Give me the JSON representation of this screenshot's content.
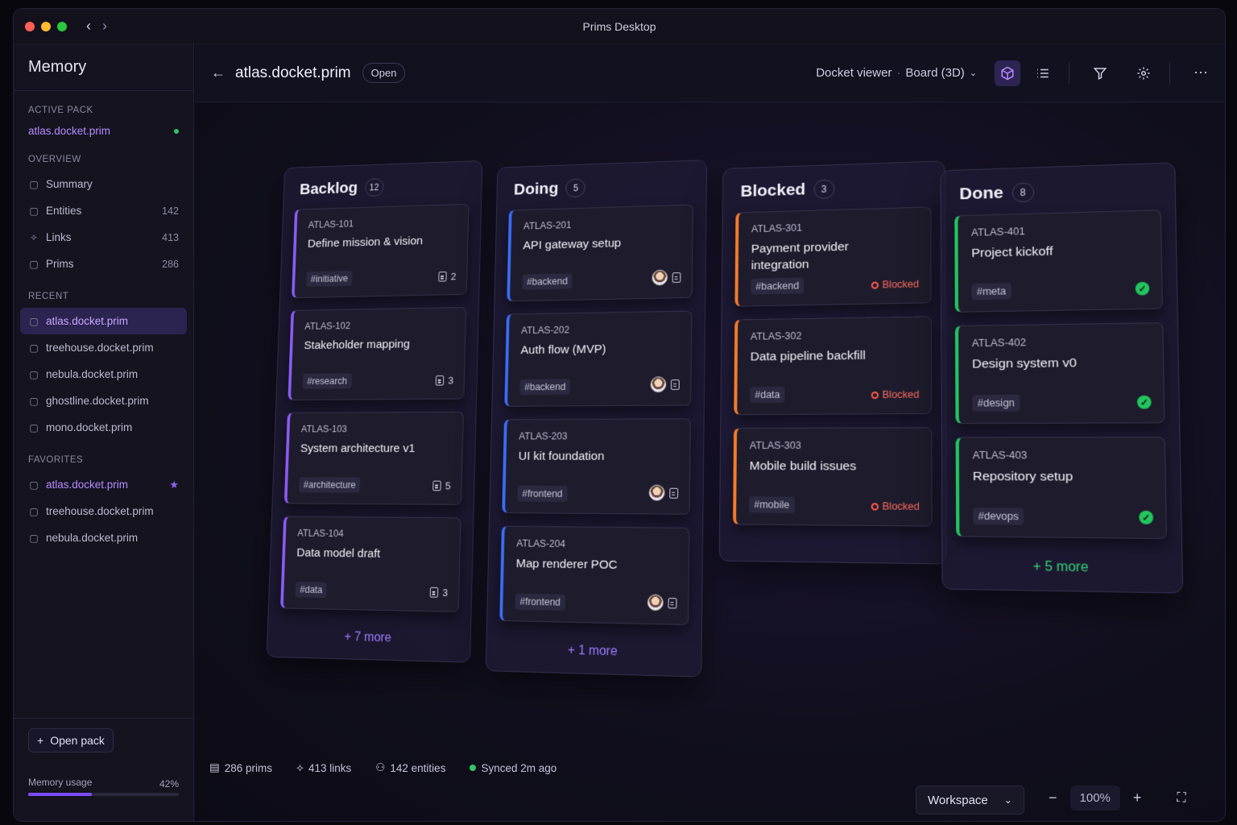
{
  "window": {
    "title": "Prims Desktop",
    "controls": [
      "#ff5f57",
      "#febc2e",
      "#28c840"
    ]
  },
  "sidebar": {
    "title": "Memory",
    "active_pack_label": "ACTIVE PACK",
    "active_pack": "atlas.docket.prim",
    "overview_label": "OVERVIEW",
    "overview": [
      {
        "label": "Summary",
        "count": "",
        "icon": "document-icon"
      },
      {
        "label": "Entities",
        "count": "142",
        "icon": "document-icon"
      },
      {
        "label": "Links",
        "count": "413",
        "icon": "link-icon"
      },
      {
        "label": "Prims",
        "count": "286",
        "icon": "prim-icon"
      }
    ],
    "recent_label": "RECENT",
    "recent": [
      "atlas.docket.prim",
      "treehouse.docket.prim",
      "nebula.docket.prim",
      "ghostline.docket.prim",
      "mono.docket.prim"
    ],
    "favorites_label": "FAVORITES",
    "favorites": [
      "atlas.docket.prim",
      "treehouse.docket.prim",
      "nebula.docket.prim"
    ],
    "open_pack": "Open pack",
    "memory_usage_label": "Memory usage",
    "memory_usage": "42%",
    "memory_usage_fraction": 0.42
  },
  "header": {
    "doc_name": "atlas.docket.prim",
    "status_pill": "Open",
    "viewer": "Docket viewer",
    "view_mode": "Board (3D)"
  },
  "board": {
    "columns": [
      {
        "name": "Backlog",
        "count": "12",
        "accent": "#8b5cf6",
        "more": "+ 7 more",
        "cards": [
          {
            "id": "ATLAS-101",
            "title": "Define mission & vision",
            "tag": "#initiative",
            "docs": "2"
          },
          {
            "id": "ATLAS-102",
            "title": "Stakeholder mapping",
            "tag": "#research",
            "docs": "3"
          },
          {
            "id": "ATLAS-103",
            "title": "System architecture v1",
            "tag": "#architecture",
            "docs": "5"
          },
          {
            "id": "ATLAS-104",
            "title": "Data model draft",
            "tag": "#data",
            "docs": "3"
          }
        ]
      },
      {
        "name": "Doing",
        "count": "5",
        "accent": "#3b6cf6",
        "more": "+ 1 more",
        "cards": [
          {
            "id": "ATLAS-201",
            "title": "API gateway setup",
            "tag": "#backend"
          },
          {
            "id": "ATLAS-202",
            "title": "Auth flow (MVP)",
            "tag": "#backend"
          },
          {
            "id": "ATLAS-203",
            "title": "UI kit foundation",
            "tag": "#frontend"
          },
          {
            "id": "ATLAS-204",
            "title": "Map renderer POC",
            "tag": "#frontend"
          }
        ]
      },
      {
        "name": "Blocked",
        "count": "3",
        "accent": "#f57c2a",
        "more": "",
        "cards": [
          {
            "id": "ATLAS-301",
            "title": "Payment provider integration",
            "tag": "#backend",
            "status": "Blocked"
          },
          {
            "id": "ATLAS-302",
            "title": "Data pipeline backfill",
            "tag": "#data",
            "status": "Blocked"
          },
          {
            "id": "ATLAS-303",
            "title": "Mobile build issues",
            "tag": "#mobile",
            "status": "Blocked"
          }
        ]
      },
      {
        "name": "Done",
        "count": "8",
        "accent": "#22c55e",
        "more": "+ 5 more",
        "cards": [
          {
            "id": "ATLAS-401",
            "title": "Project kickoff",
            "tag": "#meta"
          },
          {
            "id": "ATLAS-402",
            "title": "Design system v0",
            "tag": "#design"
          },
          {
            "id": "ATLAS-403",
            "title": "Repository setup",
            "tag": "#devops"
          }
        ]
      }
    ]
  },
  "status_bar": {
    "prims": "286 prims",
    "links": "413 links",
    "entities": "142 entities",
    "synced": "Synced 2m ago",
    "workspace": "Workspace",
    "zoom": "100%"
  }
}
